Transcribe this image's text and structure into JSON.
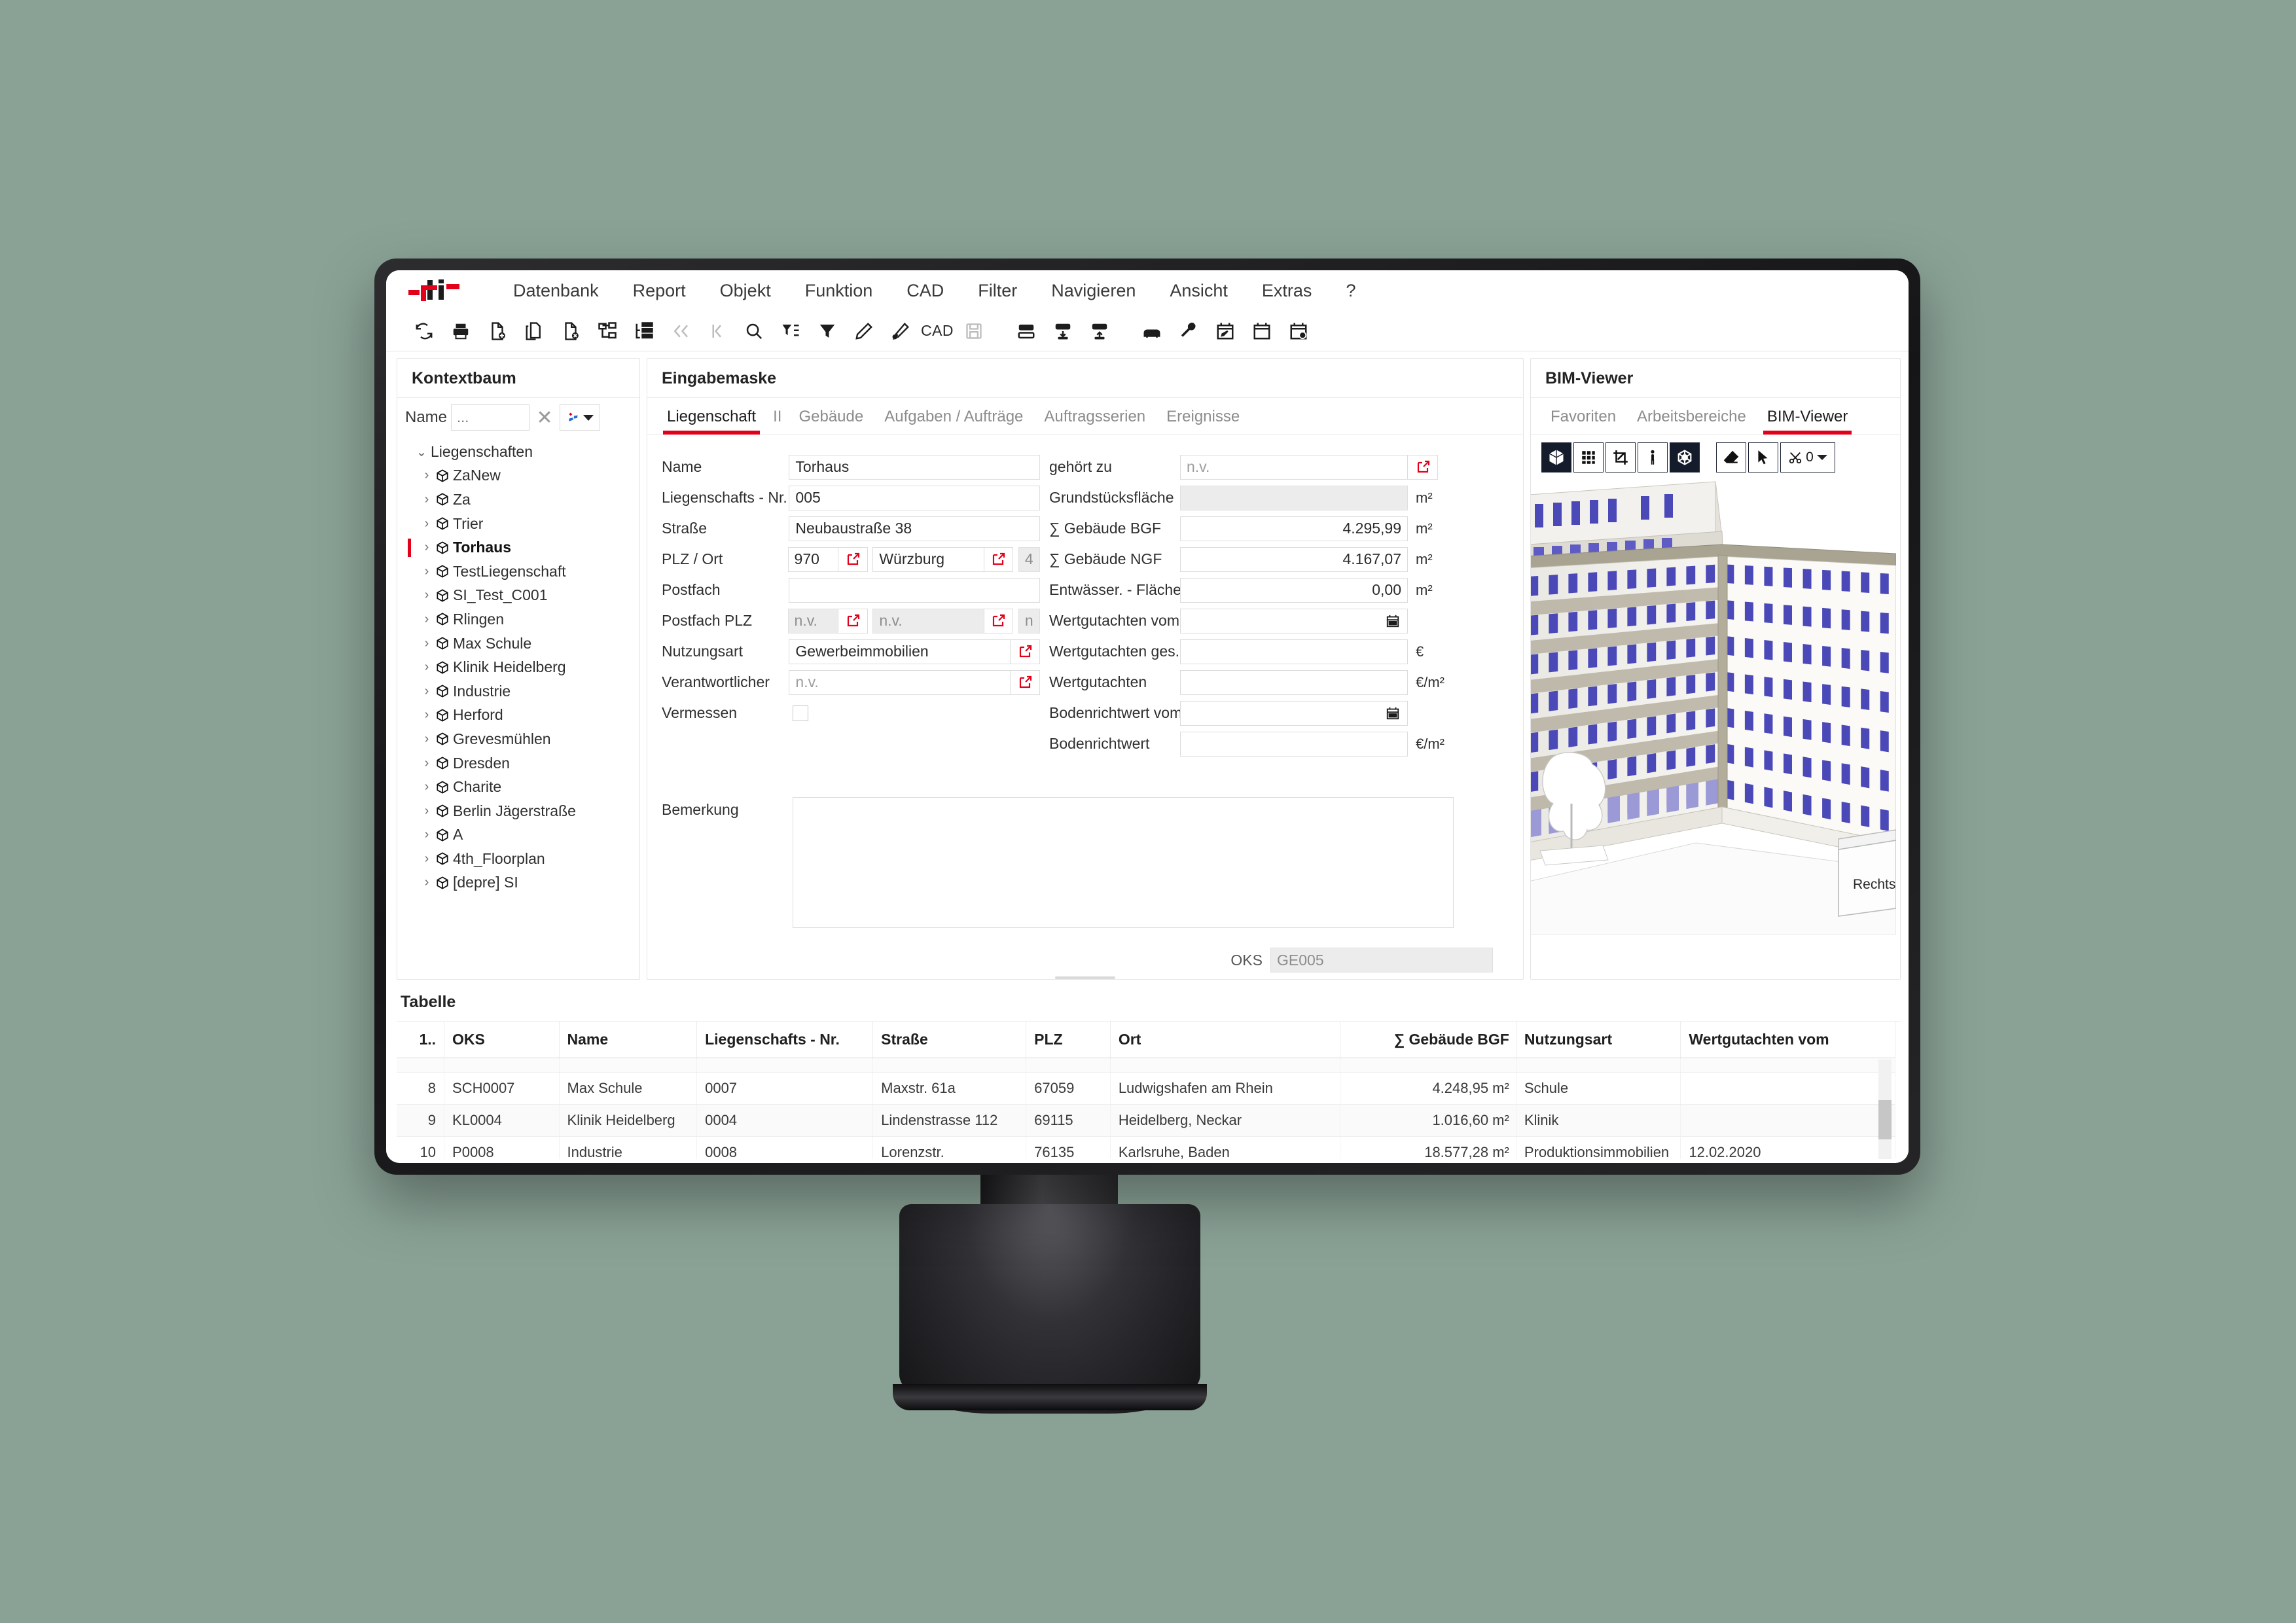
{
  "app": {
    "logo_alt": "pit-logo",
    "menu": [
      "Datenbank",
      "Report",
      "Objekt",
      "Funktion",
      "CAD",
      "Filter",
      "Navigieren",
      "Ansicht",
      "Extras",
      "?"
    ],
    "toolbar_icons": [
      "refresh-icon",
      "print-icon",
      "new-document-icon",
      "copy-document-icon",
      "delete-document-icon",
      "tree-structure-icon",
      "list-structure-icon",
      "first-record-icon",
      "previous-record-icon",
      "search-icon",
      "filter-define-icon",
      "filter-icon",
      "edit-pen-icon",
      "edit-brush-icon",
      "cad-label",
      "save-disk-icon",
      "panel-top-icon",
      "panel-import-icon",
      "panel-export-icon",
      "vehicle-icon",
      "wrench-icon",
      "calendar-edit-icon",
      "calendar-icon",
      "calendar-user-icon"
    ],
    "toolbar_cad_label": "CAD"
  },
  "tree_panel": {
    "title": "Kontextbaum",
    "search_label": "Name",
    "search_value": "",
    "search_placeholder": "...",
    "clear_icon": "close-icon",
    "filter_icon": "filter-dropdown-icon",
    "root": "Liegenschaften",
    "items": [
      {
        "label": "ZaNew",
        "selected": false
      },
      {
        "label": "Za",
        "selected": false
      },
      {
        "label": "Trier",
        "selected": false
      },
      {
        "label": "Torhaus",
        "selected": true
      },
      {
        "label": "TestLiegenschaft",
        "selected": false
      },
      {
        "label": "SI_Test_C001",
        "selected": false
      },
      {
        "label": "Rlingen",
        "selected": false
      },
      {
        "label": "Max Schule",
        "selected": false
      },
      {
        "label": "Klinik Heidelberg",
        "selected": false
      },
      {
        "label": "Industrie",
        "selected": false
      },
      {
        "label": "Herford",
        "selected": false
      },
      {
        "label": "Grevesmühlen",
        "selected": false
      },
      {
        "label": "Dresden",
        "selected": false
      },
      {
        "label": "Charite",
        "selected": false
      },
      {
        "label": "Berlin Jägerstraße",
        "selected": false
      },
      {
        "label": "A",
        "selected": false
      },
      {
        "label": "4th_Floorplan",
        "selected": false
      },
      {
        "label": "[depre] SI",
        "selected": false
      }
    ]
  },
  "form_panel": {
    "title": "Eingabemaske",
    "tabs": [
      {
        "label": "Liegenschaft",
        "active": true
      },
      {
        "label": "II",
        "active": false
      },
      {
        "label": "Gebäude",
        "active": false
      },
      {
        "label": "Aufgaben / Aufträge",
        "active": false
      },
      {
        "label": "Auftragsserien",
        "active": false
      },
      {
        "label": "Ereignisse",
        "active": false
      }
    ],
    "left_fields": {
      "name_label": "Name",
      "name_value": "Torhaus",
      "nr_label": "Liegenschafts - Nr.",
      "nr_value": "005",
      "strasse_label": "Straße",
      "strasse_value": "Neubaustraße 38",
      "plz_ort_label": "PLZ / Ort",
      "plz_value": "970",
      "ort_value": "Würzburg",
      "plz_extra_value": "4",
      "postfach_label": "Postfach",
      "postfach_value": "",
      "postfach_plz_label": "Postfach PLZ",
      "postfach_plz_value": "n.v.",
      "postfach_ort_value": "n.v.",
      "postfach_extra_value": "n",
      "nutzungsart_label": "Nutzungsart",
      "nutzungsart_value": "Gewerbeimmobilien",
      "verantwortlicher_label": "Verantwortlicher",
      "verantwortlicher_value": "n.v.",
      "vermessen_label": "Vermessen",
      "vermessen_checked": false
    },
    "right_fields": {
      "gehoert_zu_label": "gehört zu",
      "gehoert_zu_value": "n.v.",
      "grundstuecksflaeche_label": "Grundstücksfläche",
      "grundstuecksflaeche_value": "",
      "grundstuecksflaeche_unit": "m²",
      "bgf_label": "∑ Gebäude BGF",
      "bgf_value": "4.295,99",
      "bgf_unit": "m²",
      "ngf_label": "∑ Gebäude NGF",
      "ngf_value": "4.167,07",
      "ngf_unit": "m²",
      "entwaesser_label": "Entwässer. - Fläche",
      "entwaesser_value": "0,00",
      "entwaesser_unit": "m²",
      "wertgutachten_vom_label": "Wertgutachten vom",
      "wertgutachten_vom_value": "",
      "wertgutachten_ges_label": "Wertgutachten ges.",
      "wertgutachten_ges_value": "",
      "wertgutachten_ges_unit": "€",
      "wertgutachten_label": "Wertgutachten",
      "wertgutachten_value": "",
      "wertgutachten_unit": "€/m²",
      "bodenrichtwert_vom_label": "Bodenrichtwert vom",
      "bodenrichtwert_vom_value": "",
      "bodenrichtwert_label": "Bodenrichtwert",
      "bodenrichtwert_value": "",
      "bodenrichtwert_unit": "€/m²"
    },
    "bemerkung_label": "Bemerkung",
    "bemerkung_value": "",
    "oks_label": "OKS",
    "oks_value": "GE005",
    "external_link_icon": "external-link-icon",
    "calendar_icon": "calendar-icon"
  },
  "bim_panel": {
    "title": "BIM-Viewer",
    "tabs": [
      {
        "label": "Favoriten",
        "active": false
      },
      {
        "label": "Arbeitsbereiche",
        "active": false
      },
      {
        "label": "BIM-Viewer",
        "active": true
      }
    ],
    "tools": [
      {
        "icon": "cube-3d-icon",
        "active": true
      },
      {
        "icon": "grid-icon",
        "active": false
      },
      {
        "icon": "crop-icon",
        "active": false
      },
      {
        "icon": "person-scale-icon",
        "active": false
      },
      {
        "icon": "orbit-icon",
        "active": true
      },
      {
        "icon": "eraser-icon",
        "active": false
      },
      {
        "icon": "cursor-select-icon",
        "active": false
      },
      {
        "icon": "section-scissors-icon",
        "active": false,
        "value": "0",
        "chevron": "chevron-down-icon"
      }
    ],
    "nav_cube_label": "Rechts",
    "model_colors": {
      "facade": "#f3f2ee",
      "window": "#4b49b8",
      "window_light": "#a3a2dd",
      "slab": "#a9a392",
      "ground": "#ffffff"
    }
  },
  "table_panel": {
    "title": "Tabelle",
    "columns": [
      "1..",
      "OKS",
      "Name",
      "Liegenschafts - Nr.",
      "Straße",
      "PLZ",
      "Ort",
      "∑ Gebäude BGF",
      "Nutzungsart",
      "Wertgutachten vom"
    ],
    "rows": [
      {
        "idx": "8",
        "oks": "SCH0007",
        "name": "Max Schule",
        "nr": "0007",
        "strasse": "Maxstr. 61a",
        "plz": "67059",
        "ort": "Ludwigshafen am Rhein",
        "bgf": "4.248,95 m²",
        "nutzungsart": "Schule",
        "wertgutachten": ""
      },
      {
        "idx": "9",
        "oks": "KL0004",
        "name": "Klinik Heidelberg",
        "nr": "0004",
        "strasse": "Lindenstrasse 112",
        "plz": "69115",
        "ort": "Heidelberg, Neckar",
        "bgf": "1.016,60 m²",
        "nutzungsart": "Klinik",
        "wertgutachten": ""
      },
      {
        "idx": "10",
        "oks": "P0008",
        "name": "Industrie",
        "nr": "0008",
        "strasse": "Lorenzstr.",
        "plz": "76135",
        "ort": "Karlsruhe, Baden",
        "bgf": "18.577,28 m²",
        "nutzungsart": "Produktionsimmobilien",
        "wertgutachten": "12.02.2020"
      }
    ]
  },
  "colors": {
    "accent_red": "#e2001a",
    "text_dark": "#232323",
    "text_muted": "#8c8c8c",
    "border": "#dcdcdc",
    "disabled_bg": "#ececec"
  }
}
